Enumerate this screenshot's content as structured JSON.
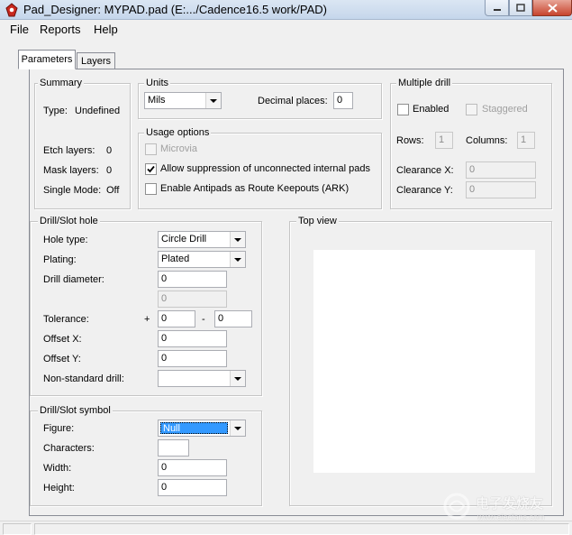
{
  "window": {
    "title": "Pad_Designer: MYPAD.pad (E:.../Cadence16.5 work/PAD)"
  },
  "menu": [
    "File",
    "Reports",
    "Help"
  ],
  "tabs": {
    "parameters": "Parameters",
    "layers": "Layers"
  },
  "summary": {
    "legend": "Summary",
    "type_label": "Type:",
    "type_value": "Undefined",
    "etch_label": "Etch layers:",
    "etch_value": "0",
    "mask_label": "Mask layers:",
    "mask_value": "0",
    "single_label": "Single Mode:",
    "single_value": "Off"
  },
  "units": {
    "legend": "Units",
    "unit_value": "Mils",
    "decimal_label": "Decimal places:",
    "decimal_value": "0"
  },
  "usage": {
    "legend": "Usage options",
    "microvia": "Microvia",
    "allow": "Allow suppression of unconnected internal pads",
    "antipads": "Enable Antipads as Route Keepouts (ARK)"
  },
  "multidrill": {
    "legend": "Multiple drill",
    "enabled": "Enabled",
    "staggered": "Staggered",
    "rows_label": "Rows:",
    "rows_value": "1",
    "cols_label": "Columns:",
    "cols_value": "1",
    "clrx_label": "Clearance X:",
    "clrx_value": "0",
    "clry_label": "Clearance Y:",
    "clry_value": "0"
  },
  "drill": {
    "legend": "Drill/Slot hole",
    "hole_label": "Hole type:",
    "hole_value": "Circle Drill",
    "plating_label": "Plating:",
    "plating_value": "Plated",
    "diam_label": "Drill diameter:",
    "diam_value": "0",
    "diam2_value": "0",
    "tol_label": "Tolerance:",
    "plus": "+",
    "minus": "-",
    "tol_plus": "0",
    "tol_minus": "0",
    "offx_label": "Offset X:",
    "offx_value": "0",
    "offy_label": "Offset Y:",
    "offy_value": "0",
    "nonstd_label": "Non-standard drill:",
    "nonstd_value": ""
  },
  "symbol": {
    "legend": "Drill/Slot symbol",
    "figure_label": "Figure:",
    "figure_value": "Null",
    "chars_label": "Characters:",
    "chars_value": "",
    "width_label": "Width:",
    "width_value": "0",
    "height_label": "Height:",
    "height_value": "0"
  },
  "topview": {
    "legend": "Top view"
  },
  "watermark": {
    "cn": "电子发烧友",
    "url": "www.elecfans.com"
  }
}
